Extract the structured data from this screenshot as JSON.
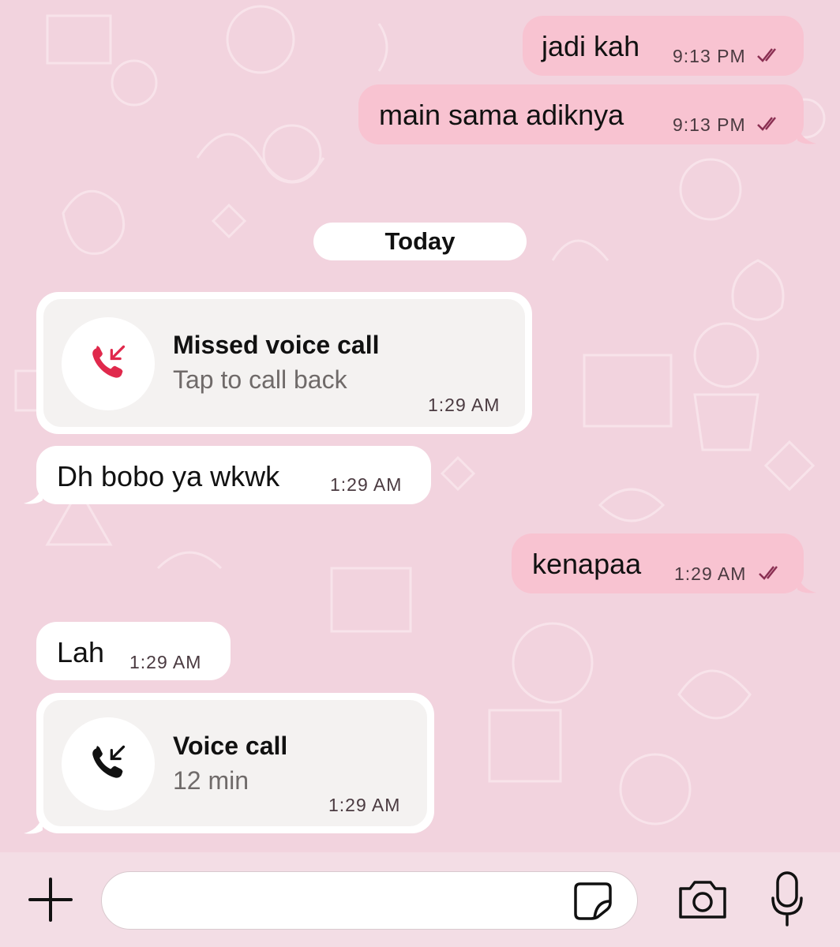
{
  "messages": {
    "m1": {
      "text": "jadi kah",
      "time": "9:13 PM"
    },
    "m2": {
      "text": "main sama adiknya",
      "time": "9:13 PM"
    },
    "date_separator": "Today",
    "missed_call": {
      "title": "Missed voice call",
      "subtitle": "Tap to call back",
      "time": "1:29 AM"
    },
    "m3": {
      "text": "Dh bobo ya wkwk",
      "time": "1:29 AM"
    },
    "m4": {
      "text": "kenapaa",
      "time": "1:29 AM"
    },
    "m5": {
      "text": "Lah",
      "time": "1:29 AM"
    },
    "voice_call": {
      "title": "Voice call",
      "subtitle": "12 min",
      "time": "1:29 AM"
    }
  },
  "composer": {
    "placeholder": ""
  },
  "icons": {
    "add": "plus-icon",
    "sticker": "sticker-icon",
    "camera": "camera-icon",
    "mic": "microphone-icon",
    "missed_call": "missed-call-icon",
    "incoming_call": "incoming-call-icon",
    "read_receipt": "double-check-icon"
  },
  "colors": {
    "wallpaper": "#f2d3de",
    "outgoing_bubble": "#f8c3d1",
    "incoming_bubble": "#ffffff",
    "missed_call_red": "#e0294c",
    "read_ticks": "#8a2f52"
  }
}
